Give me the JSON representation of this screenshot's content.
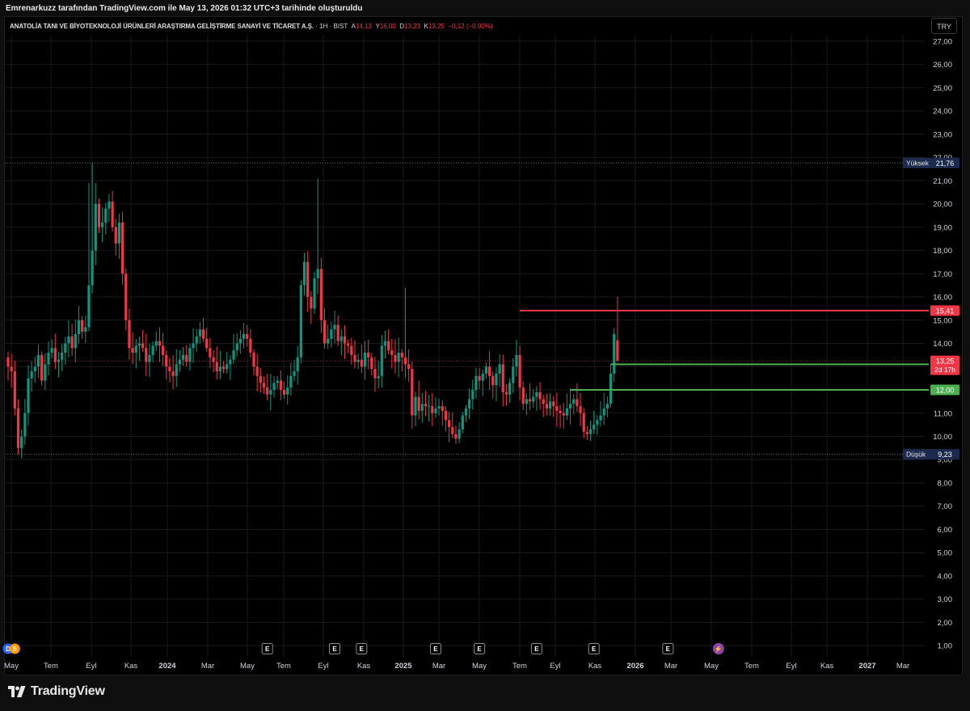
{
  "header": {
    "credit": "Emrenarkuzz tarafından TradingView.com ile May 13, 2026 01:32 UTC+3 tarihinde oluşturuldu"
  },
  "legend": {
    "symbol": "ANATOLİA TANI VE BİYOTEKNOLOJİ ÜRÜNLERİ ARAŞTIRMA GELİŞTİRME SANAYİ VE TİCARET A.Ş.",
    "interval": "1H",
    "exchange": "BIST",
    "open_label": "A",
    "open": "14,13",
    "high_label": "Y",
    "high": "16,00",
    "low_label": "D",
    "low": "13,23",
    "close_label": "K",
    "close": "13,25",
    "change": "−0,12 (−0,90%)"
  },
  "currency_button": "TRY",
  "footer": {
    "brand": "TradingView"
  },
  "colors": {
    "up": "#089981",
    "down": "#f23645",
    "support": "#4caf50",
    "resistance": "#f23645",
    "background": "#000000",
    "grid": "#1a1a1a",
    "axis_text": "#d1d4dc",
    "event_badge": "#434651",
    "high_low_badge": "#1c2a4e"
  },
  "chart_data": {
    "type": "candlestick",
    "interval": "1W",
    "price_axis": {
      "range": [
        0.5,
        27.7
      ],
      "ticks": [
        "1,00",
        "2,00",
        "3,00",
        "4,00",
        "5,00",
        "6,00",
        "7,00",
        "8,00",
        "9,00",
        "10,00",
        "11,00",
        "12,00",
        "13,00",
        "14,00",
        "15,00",
        "16,00",
        "17,00",
        "18,00",
        "19,00",
        "20,00",
        "21,00",
        "22,00",
        "23,00",
        "24,00",
        "25,00",
        "26,00",
        "27,00"
      ]
    },
    "time_axis": [
      {
        "label": "May",
        "bold": false
      },
      {
        "label": "Tem",
        "bold": false
      },
      {
        "label": "Eyl",
        "bold": false
      },
      {
        "label": "Kas",
        "bold": false
      },
      {
        "label": "2024",
        "bold": true
      },
      {
        "label": "Mar",
        "bold": false
      },
      {
        "label": "May",
        "bold": false
      },
      {
        "label": "Tem",
        "bold": false
      },
      {
        "label": "Eyl",
        "bold": false
      },
      {
        "label": "Kas",
        "bold": false
      },
      {
        "label": "2025",
        "bold": true
      },
      {
        "label": "Mar",
        "bold": false
      },
      {
        "label": "May",
        "bold": false
      },
      {
        "label": "Tem",
        "bold": false
      },
      {
        "label": "Eyl",
        "bold": false
      },
      {
        "label": "Kas",
        "bold": false
      },
      {
        "label": "2026",
        "bold": true
      },
      {
        "label": "Mar",
        "bold": false
      },
      {
        "label": "May",
        "bold": false
      },
      {
        "label": "Tem",
        "bold": false
      },
      {
        "label": "Eyl",
        "bold": false
      },
      {
        "label": "Kas",
        "bold": false
      },
      {
        "label": "2027",
        "bold": true
      },
      {
        "label": "Mar",
        "bold": false
      }
    ],
    "high_marker": {
      "label": "Yüksek",
      "value": 21.76,
      "text": "21,76"
    },
    "low_marker": {
      "label": "Düşük",
      "value": 9.23,
      "text": "9,23"
    },
    "last_price": {
      "value": 13.25,
      "text": "13,25",
      "countdown": "2d 17h"
    },
    "horizontal_lines": [
      {
        "name": "resistance",
        "value": 15.41,
        "text": "15,41",
        "color": "#f23645",
        "start_index": 152
      },
      {
        "name": "support-upper",
        "value": 13.1,
        "text": "",
        "color": "#4caf50",
        "start_index": 179
      },
      {
        "name": "support-lower",
        "value": 12.0,
        "text": "12,00",
        "color": "#4caf50",
        "start_index": 167
      }
    ],
    "events": [
      {
        "label": "D",
        "kind": "dividend",
        "index": 0
      },
      {
        "label": "S",
        "kind": "split",
        "index": 2
      },
      {
        "label": "E",
        "kind": "earnings",
        "index": 77
      },
      {
        "label": "E",
        "kind": "earnings",
        "index": 97
      },
      {
        "label": "E",
        "kind": "earnings",
        "index": 105
      },
      {
        "label": "E",
        "kind": "earnings",
        "index": 127
      },
      {
        "label": "E",
        "kind": "earnings",
        "index": 140
      },
      {
        "label": "E",
        "kind": "earnings",
        "index": 157
      },
      {
        "label": "E",
        "kind": "earnings",
        "index": 174
      },
      {
        "label": "E",
        "kind": "earnings",
        "index": 196
      },
      {
        "label": "⚡",
        "kind": "flash",
        "index": 211
      }
    ],
    "closes": [
      13.0,
      12.8,
      11.2,
      9.5,
      10.0,
      11.0,
      12.5,
      12.8,
      13.0,
      13.5,
      12.4,
      13.1,
      13.6,
      13.8,
      13.2,
      13.3,
      13.6,
      14.0,
      14.3,
      13.8,
      14.4,
      15.0,
      14.5,
      14.7,
      16.5,
      18.0,
      20.0,
      19.0,
      19.2,
      19.8,
      20.1,
      19.0,
      18.3,
      19.2,
      17.0,
      15.0,
      13.8,
      13.6,
      13.9,
      14.0,
      13.8,
      13.2,
      13.5,
      13.9,
      14.1,
      13.9,
      13.5,
      13.0,
      12.8,
      12.6,
      13.1,
      13.3,
      13.5,
      13.2,
      13.8,
      14.0,
      14.3,
      14.6,
      14.2,
      13.8,
      13.4,
      13.2,
      12.8,
      13.0,
      12.9,
      13.1,
      13.3,
      13.7,
      14.0,
      14.2,
      14.4,
      14.2,
      13.6,
      13.0,
      12.6,
      12.3,
      12.1,
      11.8,
      12.0,
      12.3,
      12.4,
      12.0,
      11.8,
      12.1,
      12.6,
      12.8,
      13.4,
      16.5,
      17.5,
      16.0,
      15.5,
      16.8,
      17.2,
      15.0,
      14.0,
      14.2,
      14.6,
      14.8,
      14.1,
      14.3,
      14.0,
      13.9,
      13.5,
      13.2,
      13.3,
      13.0,
      13.6,
      13.4,
      12.9,
      12.5,
      12.6,
      13.9,
      14.1,
      13.7,
      13.5,
      13.2,
      13.6,
      13.4,
      13.1,
      12.9,
      10.9,
      11.7,
      11.1,
      11.4,
      11.3,
      11.3,
      11.0,
      11.2,
      11.3,
      11.1,
      10.7,
      10.4,
      10.1,
      9.9,
      10.3,
      10.9,
      11.2,
      11.6,
      12.0,
      12.6,
      12.4,
      12.7,
      13.0,
      12.6,
      12.2,
      12.7,
      13.1,
      11.9,
      11.8,
      12.3,
      13.0,
      13.5,
      12.1,
      11.4,
      11.6,
      11.5,
      11.7,
      11.9,
      11.6,
      11.4,
      11.2,
      11.5,
      11.3,
      11.1,
      11.0,
      10.9,
      11.2,
      11.4,
      11.6,
      11.3,
      11.0,
      10.2,
      10.1,
      10.3,
      10.5,
      10.7,
      10.9,
      11.2,
      11.4,
      12.7,
      14.4,
      13.25
    ],
    "opens": [
      13.4,
      13.0,
      12.8,
      11.2,
      9.5,
      10.0,
      11.0,
      12.5,
      12.8,
      13.0,
      13.5,
      12.4,
      13.1,
      13.6,
      13.8,
      13.2,
      13.3,
      13.6,
      14.0,
      14.3,
      13.8,
      14.4,
      15.0,
      14.5,
      14.7,
      16.5,
      18.0,
      20.0,
      19.0,
      19.2,
      19.8,
      20.1,
      19.0,
      18.3,
      19.2,
      17.0,
      15.0,
      13.8,
      13.6,
      13.9,
      14.0,
      13.8,
      13.2,
      13.5,
      13.9,
      14.1,
      13.9,
      13.5,
      13.0,
      12.8,
      12.6,
      13.1,
      13.3,
      13.5,
      13.2,
      13.8,
      14.0,
      14.3,
      14.6,
      14.2,
      13.8,
      13.4,
      13.2,
      12.8,
      13.0,
      12.9,
      13.1,
      13.3,
      13.7,
      14.0,
      14.2,
      14.4,
      14.2,
      13.6,
      13.0,
      12.6,
      12.3,
      12.1,
      11.8,
      12.0,
      12.3,
      12.4,
      12.0,
      11.8,
      12.1,
      12.6,
      12.8,
      13.4,
      16.5,
      17.5,
      16.0,
      15.5,
      16.8,
      17.2,
      15.0,
      14.0,
      14.2,
      14.6,
      14.8,
      14.1,
      14.3,
      14.0,
      13.9,
      13.5,
      13.2,
      13.3,
      13.0,
      13.6,
      13.4,
      12.9,
      12.5,
      12.6,
      13.9,
      14.1,
      13.7,
      13.5,
      13.2,
      13.6,
      13.4,
      13.1,
      12.9,
      10.9,
      11.7,
      11.1,
      11.4,
      11.3,
      11.3,
      11.0,
      11.2,
      11.3,
      11.1,
      10.7,
      10.4,
      10.1,
      9.9,
      10.3,
      10.9,
      11.2,
      11.6,
      12.0,
      12.6,
      12.4,
      12.7,
      13.0,
      12.6,
      12.2,
      12.7,
      13.1,
      11.9,
      11.8,
      12.3,
      13.0,
      13.5,
      12.1,
      11.4,
      11.6,
      11.5,
      11.7,
      11.9,
      11.6,
      11.4,
      11.2,
      11.5,
      11.3,
      11.1,
      11.0,
      10.9,
      11.2,
      11.4,
      11.6,
      11.3,
      11.0,
      10.2,
      10.1,
      10.3,
      10.5,
      10.7,
      10.9,
      11.2,
      11.4,
      12.7,
      14.13
    ]
  }
}
